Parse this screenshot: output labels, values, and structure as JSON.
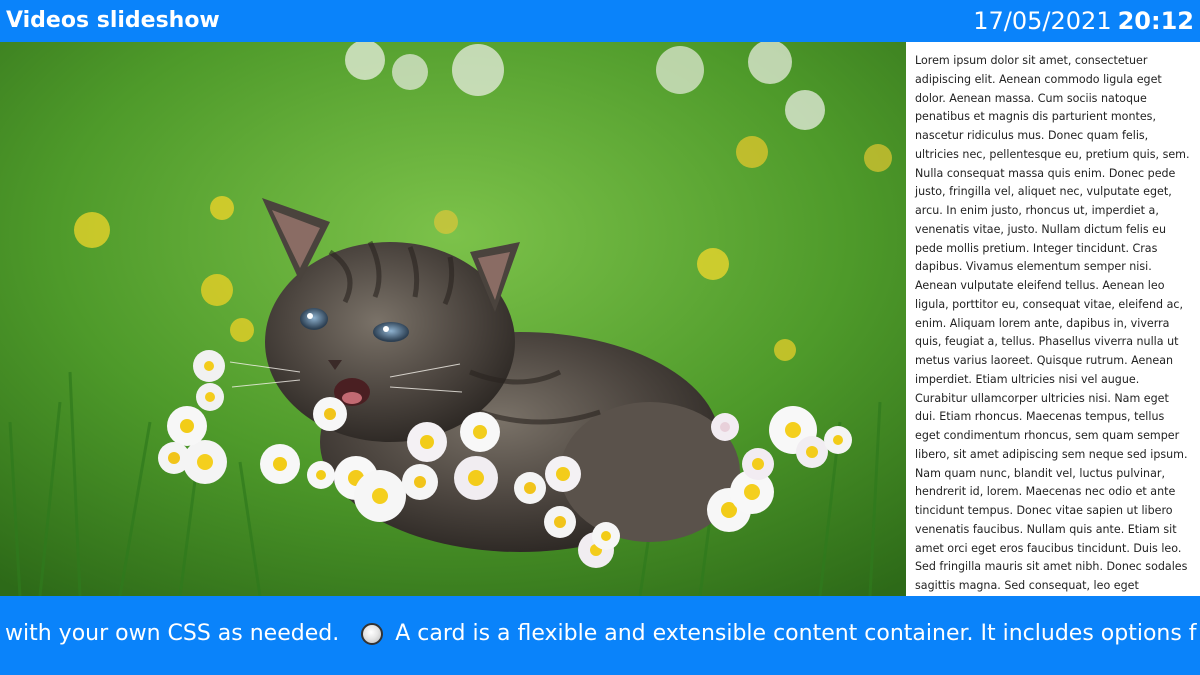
{
  "header": {
    "title": "Videos slideshow",
    "date": "17/05/2021",
    "time": "20:12"
  },
  "media": {
    "icon": "kitten-photo"
  },
  "side_text": {
    "body": "Lorem ipsum dolor sit amet, consectetuer adipiscing elit. Aenean commodo ligula eget dolor. Aenean massa. Cum sociis natoque penatibus et magnis dis parturient montes, nascetur ridiculus mus. Donec quam felis, ultricies nec, pellentesque eu, pretium quis, sem. Nulla consequat massa quis enim. Donec pede justo, fringilla vel, aliquet nec, vulputate eget, arcu. In enim justo, rhoncus ut, imperdiet a, venenatis vitae, justo. Nullam dictum felis eu pede mollis pretium. Integer tincidunt. Cras dapibus. Vivamus elementum semper nisi. Aenean vulputate eleifend tellus. Aenean leo ligula, porttitor eu, consequat vitae, eleifend ac, enim. Aliquam lorem ante, dapibus in, viverra quis, feugiat a, tellus. Phasellus viverra nulla ut metus varius laoreet. Quisque rutrum. Aenean imperdiet. Etiam ultricies nisi vel augue. Curabitur ullamcorper ultricies nisi. Nam eget dui. Etiam rhoncus. Maecenas tempus, tellus eget condimentum rhoncus, sem quam semper libero, sit amet adipiscing sem neque sed ipsum. Nam quam nunc, blandit vel, luctus pulvinar, hendrerit id, lorem. Maecenas nec odio et ante tincidunt tempus. Donec vitae sapien ut libero venenatis faucibus. Nullam quis ante. Etiam sit amet orci eget eros faucibus tincidunt. Duis leo. Sed fringilla mauris sit amet nibh. Donec sodales sagittis magna. Sed consequat, leo eget bibendum"
  },
  "ticker": {
    "text_before": "with your own CSS as needed.",
    "separator_icon": "circle-bullet-icon",
    "text_after": "A card is a flexible and extensible content container. It includes options f"
  },
  "colors": {
    "accent": "#0a83fa",
    "panel_bg": "#ffffff"
  }
}
